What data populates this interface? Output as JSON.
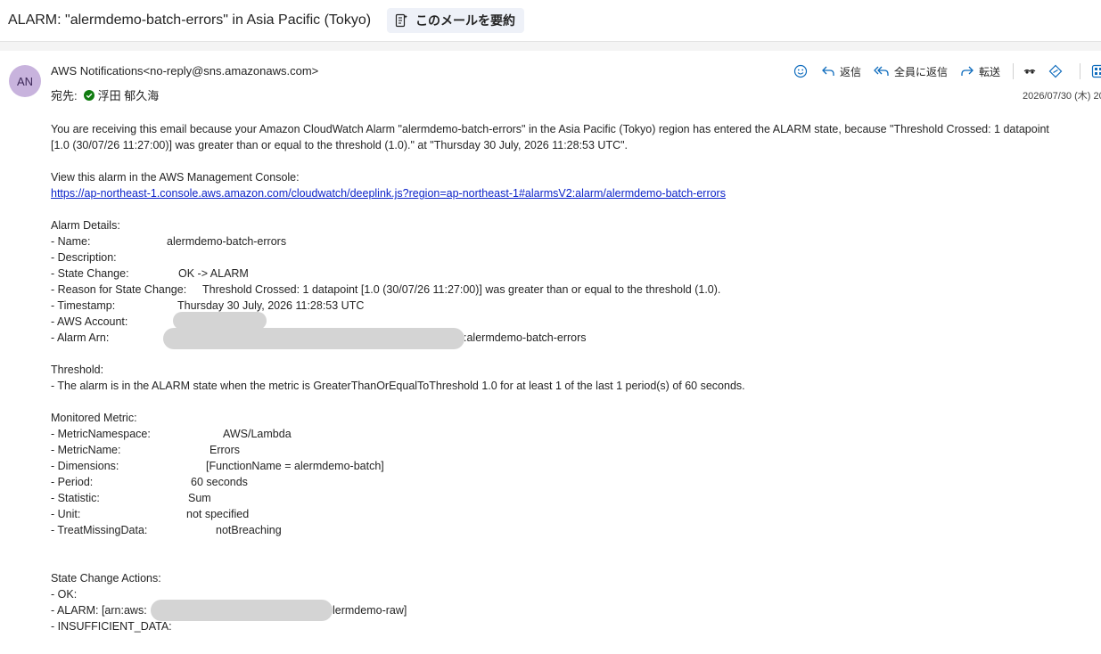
{
  "subject": "ALARM: \"alermdemo-batch-errors\" in Asia Pacific (Tokyo)",
  "summarize_label": "このメールを要約",
  "sender": {
    "initials": "AN",
    "name_address": "AWS Notifications<no-reply@sns.amazonaws.com>",
    "to_label": "宛先:",
    "recipient": "浮田 郁久海",
    "date": "2026/07/30 (木) 20"
  },
  "actions": {
    "reply": "返信",
    "reply_all": "全員に返信",
    "forward": "転送"
  },
  "body": {
    "intro_line1": "You are receiving this email because your Amazon CloudWatch Alarm \"alermdemo-batch-errors\" in the Asia Pacific (Tokyo) region has entered the ALARM state, because \"Threshold Crossed: 1 datapoint",
    "intro_line2": "[1.0 (30/07/26 11:27:00)] was greater than or equal to the threshold (1.0).\" at \"Thursday 30 July, 2026 11:28:53 UTC\".",
    "view_console": "View this alarm in the AWS Management Console:",
    "console_url": "https://ap-northeast-1.console.aws.amazon.com/cloudwatch/deeplink.js?region=ap-northeast-1#alarmsV2:alarm/alermdemo-batch-errors",
    "alarm_details_heading": "Alarm Details:",
    "details": [
      {
        "key": "- Name:",
        "value": "alermdemo-batch-errors"
      },
      {
        "key": "- Description:",
        "value": ""
      },
      {
        "key": "- State Change:",
        "value": "OK -> ALARM"
      },
      {
        "key": "- Reason for State Change:",
        "value": "Threshold Crossed: 1 datapoint [1.0 (30/07/26 11:27:00)] was greater than or equal to the threshold (1.0)."
      },
      {
        "key": "- Timestamp:",
        "value": "Thursday 30 July, 2026 11:28:53 UTC"
      },
      {
        "key": "- AWS Account:",
        "value": ""
      },
      {
        "key": "- Alarm Arn:",
        "value": ":alermdemo-batch-errors"
      }
    ],
    "threshold_heading": "Threshold:",
    "threshold_text": "- The alarm is in the ALARM state when the metric is GreaterThanOrEqualToThreshold 1.0 for at least 1 of the last 1 period(s) of 60 seconds.",
    "metric_heading": "Monitored Metric:",
    "metric": [
      {
        "key": "- MetricNamespace:",
        "value": "AWS/Lambda"
      },
      {
        "key": "- MetricName:",
        "value": "Errors"
      },
      {
        "key": "- Dimensions:",
        "value": "[FunctionName = alermdemo-batch]"
      },
      {
        "key": "- Period:",
        "value": "60 seconds"
      },
      {
        "key": "- Statistic:",
        "value": "Sum"
      },
      {
        "key": "- Unit:",
        "value": "not specified"
      },
      {
        "key": "- TreatMissingData:",
        "value": "notBreaching"
      }
    ],
    "actions_heading": "State Change Actions:",
    "state_actions": [
      {
        "key": "- OK:",
        "value": ""
      },
      {
        "key": "- ALARM: [arn:aws:",
        "value": "lermdemo-raw]"
      },
      {
        "key": "- INSUFFICIENT_DATA:",
        "value": ""
      }
    ]
  },
  "colors": {
    "accent": "#0f6cbd",
    "link": "#0b22c9",
    "avatar_bg": "#c8b3dd",
    "verified": "#107c10",
    "redaction": "#d4d4d4"
  },
  "icons": [
    "document-summary-icon",
    "emoji-icon",
    "reply-icon",
    "reply-all-icon",
    "forward-icon",
    "immersive-reader-icon",
    "translate-icon",
    "apps-icon",
    "verified-check-icon"
  ]
}
